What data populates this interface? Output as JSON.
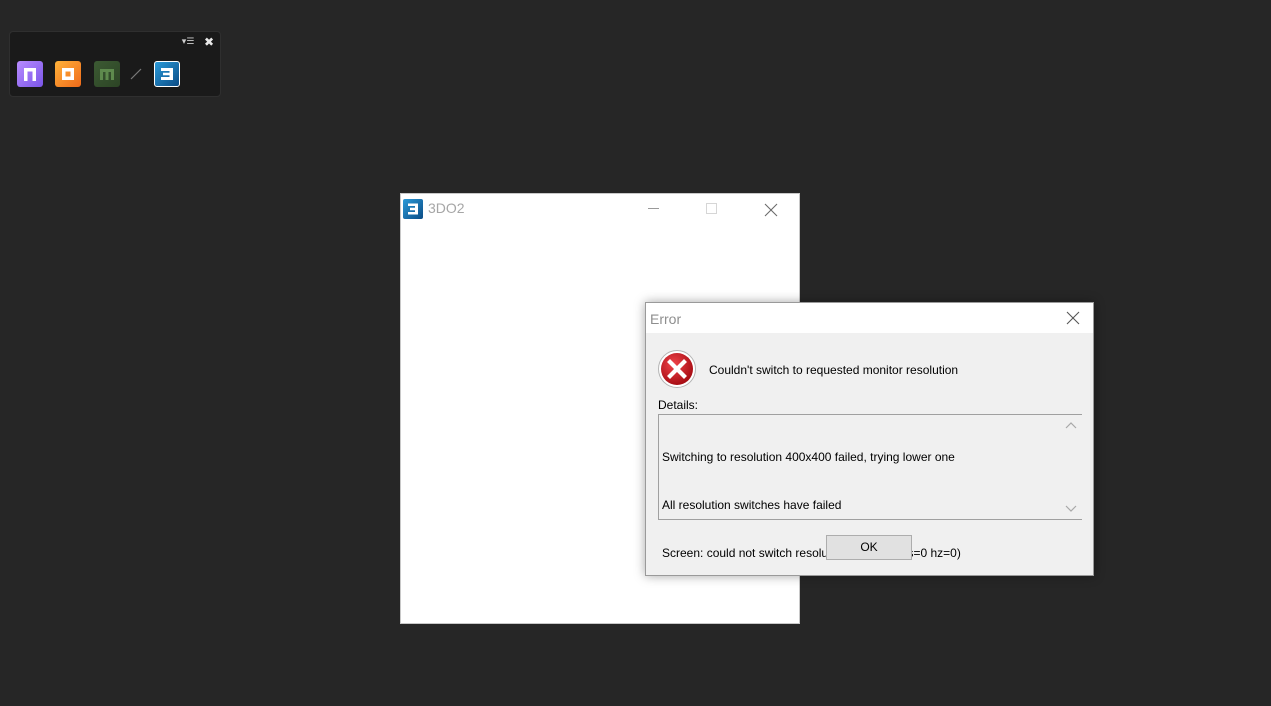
{
  "launcher": {
    "menu_icon": "dropdown-menu-icon",
    "close_icon": "close-icon",
    "apps": [
      {
        "name": "n-app",
        "color": "#9a6cf5",
        "icon": "n-logo-icon"
      },
      {
        "name": "o-app",
        "color": "#f78a2a",
        "icon": "o-logo-icon"
      },
      {
        "name": "m-app",
        "color": "#345028",
        "icon": "m-logo-icon"
      },
      {
        "name": "3do2-app",
        "color": "#1a78bb",
        "icon": "3-logo-icon"
      }
    ]
  },
  "app_window": {
    "title": "3DO2",
    "icon": "3-logo-icon"
  },
  "dialog": {
    "title": "Error",
    "message": "Couldn't switch to requested monitor resolution",
    "details_label": "Details:",
    "details_lines": [
      "Switching to resolution 400x400 failed, trying lower one",
      "All resolution switches have failed",
      "Screen: could not switch resolution (400x400 fs=0 hz=0)"
    ],
    "ok_label": "OK",
    "error_color": "#c8161e"
  }
}
